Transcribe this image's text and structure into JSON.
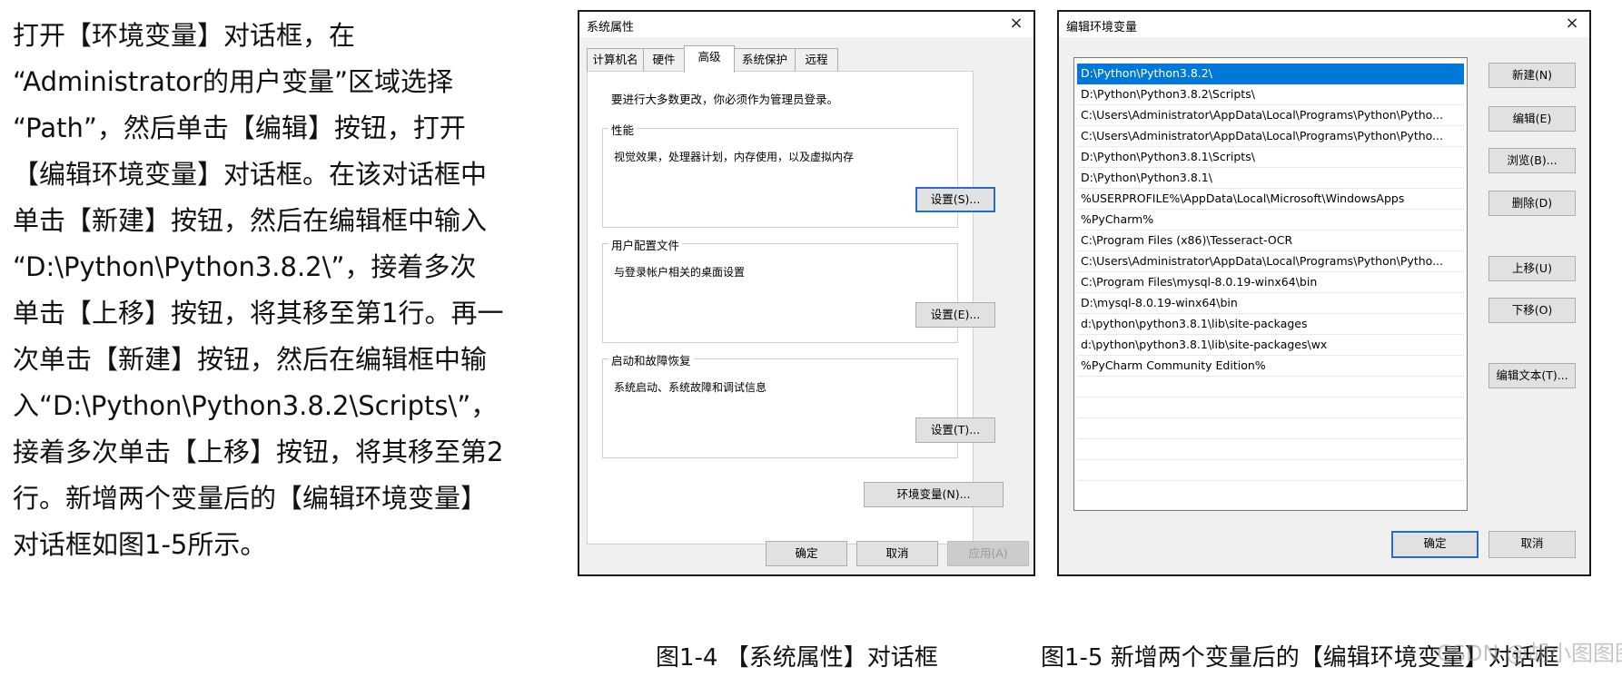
{
  "instructions": [
    "打开【环境变量】对话框，在",
    "“Administrator的用户变量”区域选择",
    "“Path”，然后单击【编辑】按钮，打开",
    "【编辑环境变量】对话框。在该对话框中",
    "单击【新建】按钮，然后在编辑框中输入",
    "“D:\\Python\\Python3.8.2\\”，接着多次",
    "单击【上移】按钮，将其移至第1行。再一",
    "次单击【新建】按钮，然后在编辑框中输",
    "入“D:\\Python\\Python3.8.2\\Scripts\\”，",
    "接着多次单击【上移】按钮，将其移至第2",
    "行。新增两个变量后的【编辑环境变量】",
    "对话框如图1-5所示。"
  ],
  "sysprops": {
    "title": "系统属性",
    "close": "×",
    "tabs": [
      "计算机名",
      "硬件",
      "高级",
      "系统保护",
      "远程"
    ],
    "active_tab": "高级",
    "admin_note": "要进行大多数更改，你必须作为管理员登录。",
    "performance": {
      "legend": "性能",
      "desc": "视觉效果，处理器计划，内存使用，以及虚拟内存",
      "button": "设置(S)..."
    },
    "profiles": {
      "legend": "用户配置文件",
      "desc": "与登录帐户相关的桌面设置",
      "button": "设置(E)..."
    },
    "startup": {
      "legend": "启动和故障恢复",
      "desc": "系统启动、系统故障和调试信息",
      "button": "设置(T)..."
    },
    "env_button": "环境变量(N)...",
    "ok": "确定",
    "cancel": "取消",
    "apply": "应用(A)"
  },
  "enveditor": {
    "title": "编辑环境变量",
    "close": "×",
    "paths": [
      "D:\\Python\\Python3.8.2\\",
      "D:\\Python\\Python3.8.2\\Scripts\\",
      "C:\\Users\\Administrator\\AppData\\Local\\Programs\\Python\\Pytho...",
      "C:\\Users\\Administrator\\AppData\\Local\\Programs\\Python\\Pytho...",
      "D:\\Python\\Python3.8.1\\Scripts\\",
      "D:\\Python\\Python3.8.1\\",
      "%USERPROFILE%\\AppData\\Local\\Microsoft\\WindowsApps",
      "%PyCharm%",
      "C:\\Program Files (x86)\\Tesseract-OCR",
      "C:\\Users\\Administrator\\AppData\\Local\\Programs\\Python\\Pytho...",
      "C:\\Program Files\\mysql-8.0.19-winx64\\bin",
      "D:\\mysql-8.0.19-winx64\\bin",
      "d:\\python\\python3.8.1\\lib\\site-packages",
      "d:\\python\\python3.8.1\\lib\\site-packages\\wx",
      "%PyCharm Community Edition%"
    ],
    "selected_index": 0,
    "buttons": {
      "new": "新建(N)",
      "edit": "编辑(E)",
      "browse": "浏览(B)...",
      "delete": "删除(D)",
      "up": "上移(U)",
      "down": "下移(O)",
      "edit_text": "编辑文本(T)..."
    },
    "ok": "确定",
    "cancel": "取消"
  },
  "captions": {
    "fig4": "图1-4 【系统属性】对话框",
    "fig5": "图1-5 新增两个变量后的【编辑环境变量】对话框"
  },
  "watermark": "CSDN @胡小图图图图"
}
